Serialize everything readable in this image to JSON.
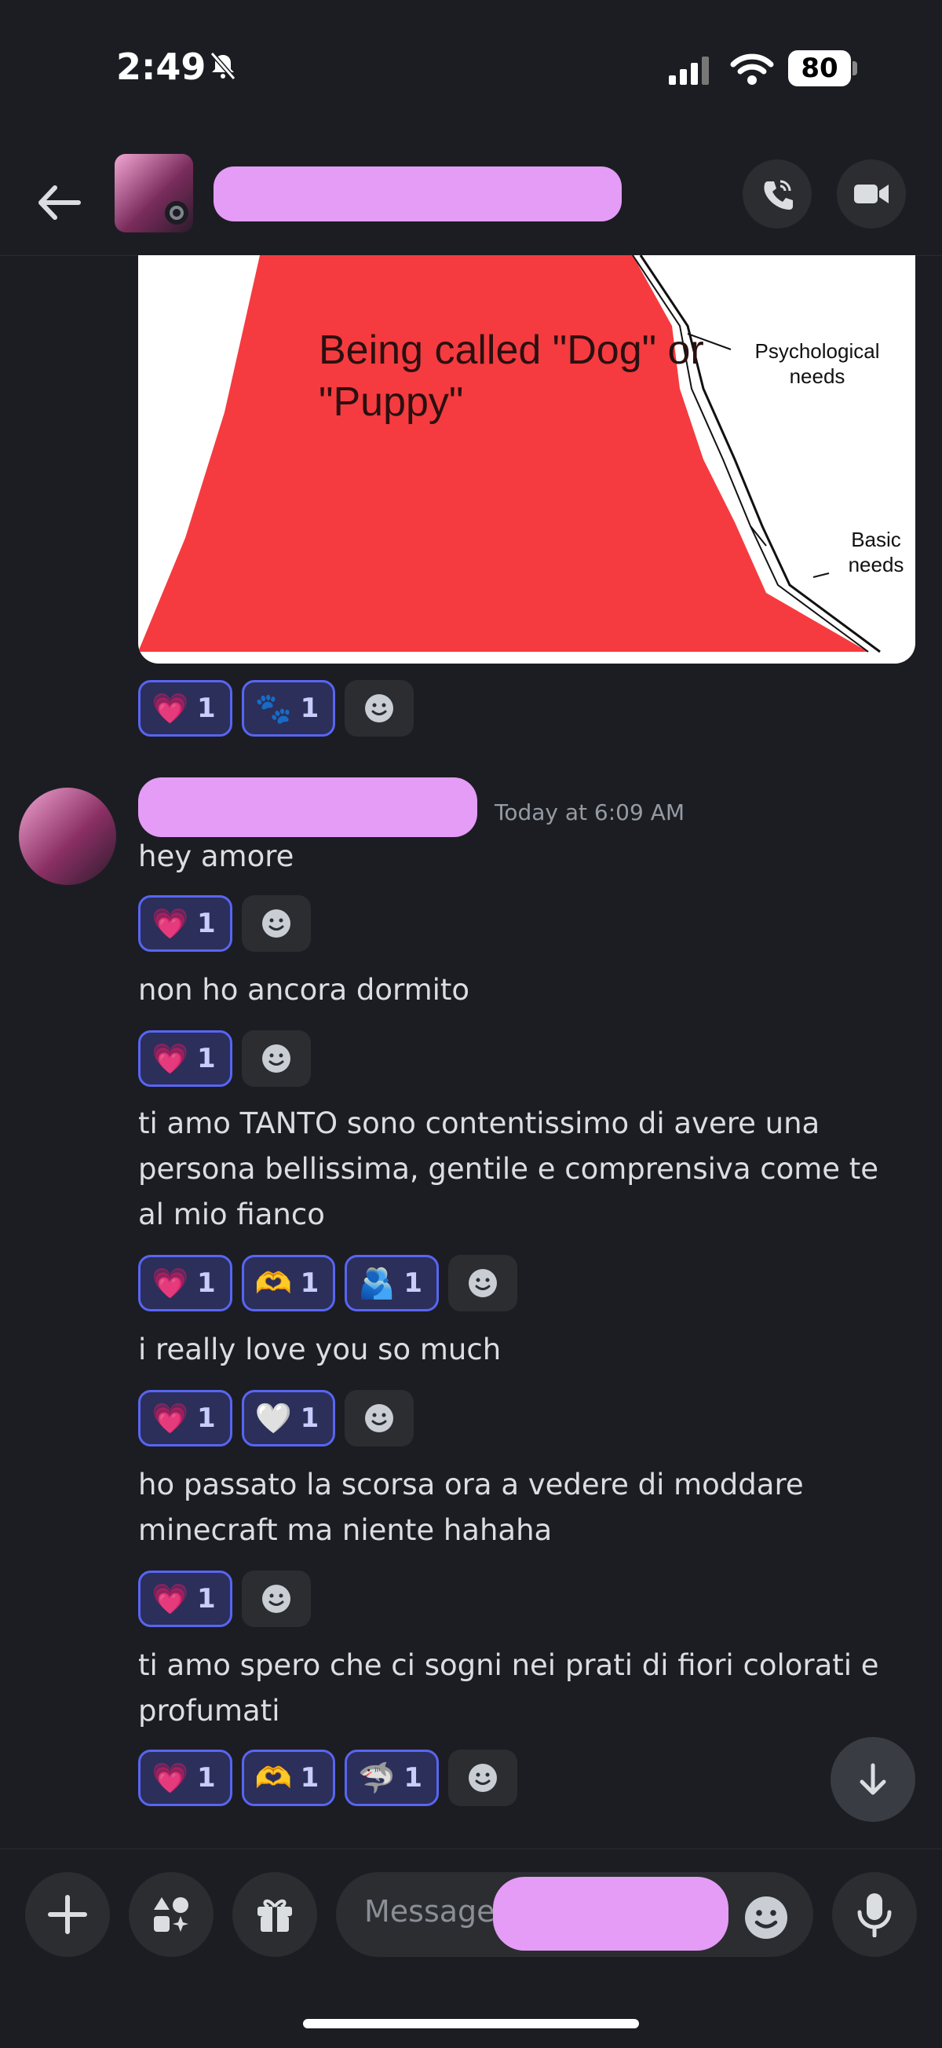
{
  "status_bar": {
    "time": "2:49",
    "battery": "80"
  },
  "header": {
    "icons": [
      "back-arrow-icon",
      "phone-call-icon",
      "video-camera-icon"
    ]
  },
  "meme": {
    "caption": "Being called \"Dog\" or \"Puppy\"",
    "label_psych": "Psychological needs",
    "label_basic": "Basic needs"
  },
  "reactions_top": [
    {
      "emoji": "💗",
      "count": "1"
    },
    {
      "emoji": "🐾",
      "count": "1"
    }
  ],
  "message_group": {
    "timestamp": "Today at 6:09 AM",
    "messages": [
      {
        "text": "hey amore",
        "reactions": [
          {
            "emoji": "💗",
            "count": "1"
          }
        ]
      },
      {
        "text": "non ho ancora dormito",
        "reactions": [
          {
            "emoji": "💗",
            "count": "1"
          }
        ]
      },
      {
        "text": "ti amo TANTO sono contentissimo di avere una persona bellissima, gentile e comprensiva come te al mio fianco",
        "reactions": [
          {
            "emoji": "💗",
            "count": "1"
          },
          {
            "emoji": "🫶",
            "count": "1"
          },
          {
            "emoji": "🫂",
            "count": "1"
          }
        ]
      },
      {
        "text": "i really love you so much",
        "reactions": [
          {
            "emoji": "💗",
            "count": "1"
          },
          {
            "emoji": "🤍",
            "count": "1"
          }
        ]
      },
      {
        "text": "ho passato la scorsa ora a vedere di moddare minecraft ma niente hahaha",
        "reactions": [
          {
            "emoji": "💗",
            "count": "1"
          }
        ]
      },
      {
        "text": "ti amo spero che ci sogni nei prati di fiori colorati e profumati",
        "reactions": [
          {
            "emoji": "💗",
            "count": "1"
          },
          {
            "emoji": "🫶",
            "count": "1"
          },
          {
            "emoji": "🦈",
            "count": "1"
          }
        ]
      }
    ]
  },
  "composer": {
    "placeholder": "Message"
  },
  "colors": {
    "accent": "#5865f2",
    "background": "#1c1d22",
    "redaction": "#e49cf7"
  }
}
